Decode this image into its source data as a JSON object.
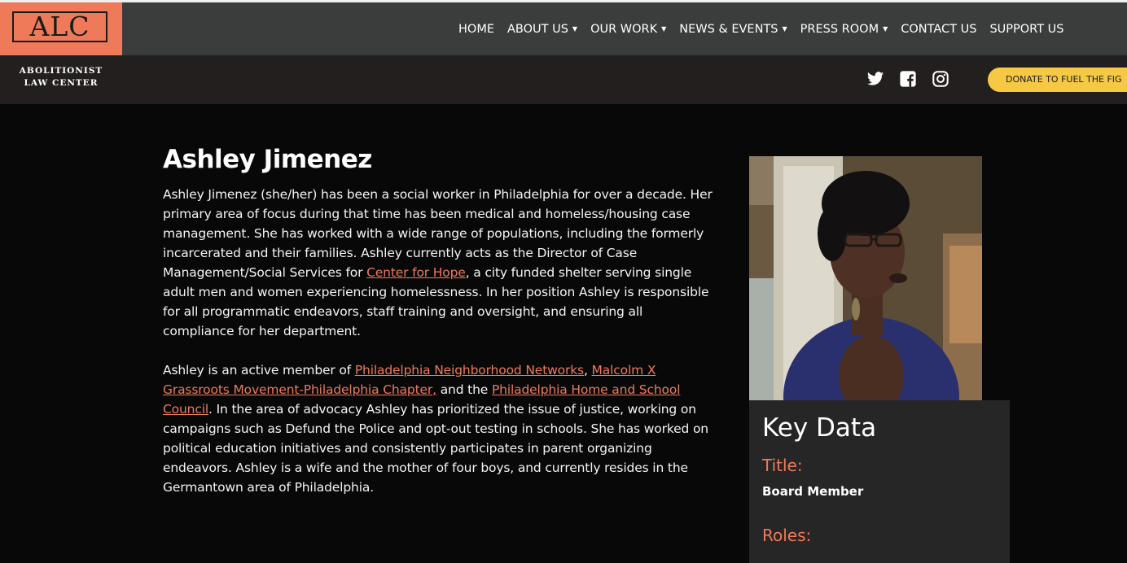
{
  "header": {
    "logo_text": "ALC",
    "org_name_line1": "ABOLITIONIST",
    "org_name_line2": "LAW CENTER",
    "nav": [
      {
        "label": "HOME",
        "has_dropdown": false
      },
      {
        "label": "ABOUT US",
        "has_dropdown": true
      },
      {
        "label": "OUR WORK",
        "has_dropdown": true
      },
      {
        "label": "NEWS & EVENTS",
        "has_dropdown": true
      },
      {
        "label": "PRESS ROOM",
        "has_dropdown": true
      },
      {
        "label": "CONTACT US",
        "has_dropdown": false
      },
      {
        "label": "SUPPORT US",
        "has_dropdown": false
      }
    ],
    "social_icons": [
      "twitter-icon",
      "facebook-icon",
      "instagram-icon"
    ],
    "donate_label": "DONATE TO FUEL THE FIG"
  },
  "profile": {
    "name": "Ashley Jimenez",
    "p1_a": "Ashley Jimenez (she/her) has been a social worker in Philadelphia for over a decade. Her primary area of focus during that time has been medical and homeless/housing case management. She has worked with a wide range of populations, including the formerly incarcerated and their families. Ashley currently acts as the Director of Case Management/Social Services for ",
    "p1_link": "Center for Hope",
    "p1_b": ", a city funded shelter serving single adult men and women experiencing homelessness. In her position Ashley is responsible for all programmatic endeavors, staff training and oversight, and ensuring all compliance for her department.",
    "p2_a": "Ashley is an active member of ",
    "p2_link1": "Philadelphia Neighborhood Networks",
    "p2_sep": ", ",
    "p2_link2": "Malcolm X Grassroots Movement-Philadelphia Chapter,",
    "p2_b": " and the ",
    "p2_link3": "Philadelphia Home and School Council",
    "p2_c": ". In the area of advocacy Ashley has prioritized the issue of justice, working on campaigns such as Defund the Police and opt-out testing in schools. She has worked on political education initiatives and consistently participates in parent organizing endeavors. Ashley is a wife and the mother of four boys, and currently resides in the Germantown area of Philadelphia."
  },
  "key_data": {
    "heading": "Key Data",
    "title_label": "Title:",
    "title_value": "Board Member",
    "roles_label": "Roles:"
  },
  "colors": {
    "accent": "#ee7a59",
    "nav_bg": "#3a3d3c",
    "subbar_bg": "#231f1e",
    "page_bg": "#080808",
    "donate_bg": "#f5c943",
    "panel_bg": "#262626"
  }
}
